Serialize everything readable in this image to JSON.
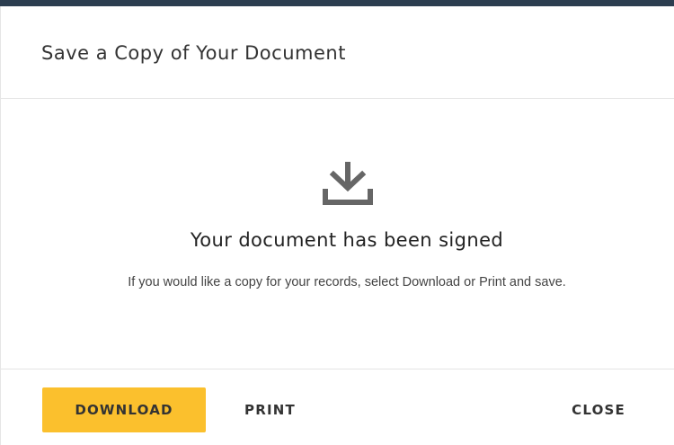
{
  "dialog": {
    "title": "Save a Copy of Your Document",
    "icon": "download-icon",
    "heading": "Your document has been signed",
    "message": "If you would like a copy for your records, select Download or Print and save."
  },
  "footer": {
    "download_label": "DOWNLOAD",
    "print_label": "PRINT",
    "close_label": "CLOSE"
  },
  "colors": {
    "top_bar": "#2c3e50",
    "primary_button": "#fbc02d",
    "text": "#333333",
    "icon": "#666666"
  }
}
